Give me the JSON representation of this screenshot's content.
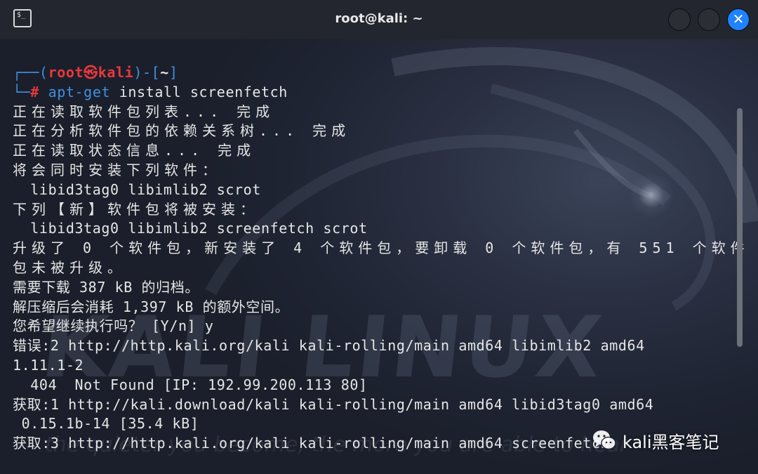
{
  "window": {
    "title": "root@kali: ~",
    "close_glyph": "✕",
    "icon": "terminal-icon",
    "icon_glyph": "$_"
  },
  "background": {
    "watermark": "KALI LINUX",
    "tagline": "the quieter you become, the more you are able to hear"
  },
  "prompt": {
    "open": "┌──(",
    "user": "root",
    "at": "㉿",
    "host": "kali",
    "close": ")-[",
    "dir": "~",
    "end": "]",
    "second": "└─",
    "hash": "#",
    "command": "apt-get",
    "args": " install screenfetch"
  },
  "output": [
    "正在读取软件包列表... 完成",
    "正在分析软件包的依赖关系树... 完成",
    "正在读取状态信息... 完成",
    "将会同时安装下列软件：",
    "  libid3tag0 libimlib2 scrot",
    "下列【新】软件包将被安装：",
    "  libid3tag0 libimlib2 screenfetch scrot",
    "升级了 0 个软件包，新安装了 4 个软件包，要卸载 0 个软件包，有 551 个软件",
    "包未被升级。",
    "需要下载 387 kB 的归档。",
    "解压缩后会消耗 1,397 kB 的额外空间。",
    "您希望继续执行吗？ [Y/n] y",
    "错误:2 http://http.kali.org/kali kali-rolling/main amd64 libimlib2 amd64",
    "1.11.1-2",
    "  404  Not Found [IP: 192.99.200.113 80]",
    "获取:1 http://kali.download/kali kali-rolling/main amd64 libid3tag0 amd64",
    " 0.15.1b-14 [35.4 kB]",
    "获取:3 http://http.kali.org/kali kali-rolling/main amd64 screenfetch"
  ],
  "brand": {
    "text": "kali黑客笔记",
    "icon": "wechat-icon"
  },
  "colors": {
    "prompt_blue": "#3f8fe0",
    "prompt_red": "#e8383b",
    "close_button": "#1f82ff",
    "text": "#e6e6e6"
  }
}
